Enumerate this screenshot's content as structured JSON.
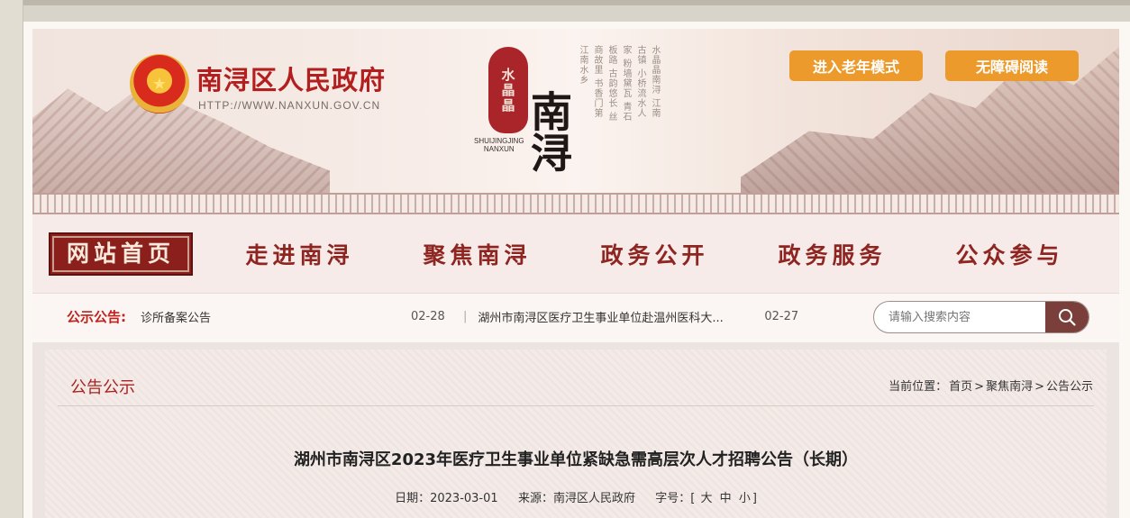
{
  "header": {
    "site_title": "南浔区人民政府",
    "site_url": "HTTP://WWW.NANXUN.GOV.CN",
    "logo_seal": "水晶晶",
    "logo_latin": "SHUIJINGJING\nNANXUN",
    "logo_big": "南浔",
    "poem": "水晶晶南浔 江南古镇 小桥流水人家 粉墙黛瓦 青石板路 古韵悠长 丝商故里 书香门第 江南水乡",
    "btn_elder": "进入老年模式",
    "btn_access": "无障碍阅读"
  },
  "nav": {
    "items": [
      "网站首页",
      "走进南浔",
      "聚焦南浔",
      "政务公开",
      "政务服务",
      "公众参与"
    ],
    "active_index": 0
  },
  "notice": {
    "label": "公示公告:",
    "items": [
      {
        "title": "诊所备案公告",
        "date": "02-28"
      },
      {
        "title": "湖州市南浔区医疗卫生事业单位赴温州医科大...",
        "date": "02-27"
      }
    ],
    "separator": "|"
  },
  "search": {
    "placeholder": "请输入搜索内容"
  },
  "content": {
    "section_title": "公告公示",
    "breadcrumb_prefix": "当前位置：",
    "breadcrumb": [
      "首页",
      "聚焦南浔",
      "公告公示"
    ],
    "article_title": "湖州市南浔区2023年医疗卫生事业单位紧缺急需高层次人才招聘公告（长期）",
    "date_label": "日期：",
    "date": "2023-03-01",
    "source_label": "来源：",
    "source": "南浔区人民政府",
    "fontsize_label": "字号：",
    "fontsize_open": "[",
    "fontsize_options": [
      "大",
      "中",
      "小"
    ],
    "fontsize_close": "]"
  },
  "colors": {
    "brand_red": "#b31e1e",
    "nav_red": "#8e2521",
    "button_orange": "#eb9a2b",
    "search_button": "#7a3f3b"
  }
}
